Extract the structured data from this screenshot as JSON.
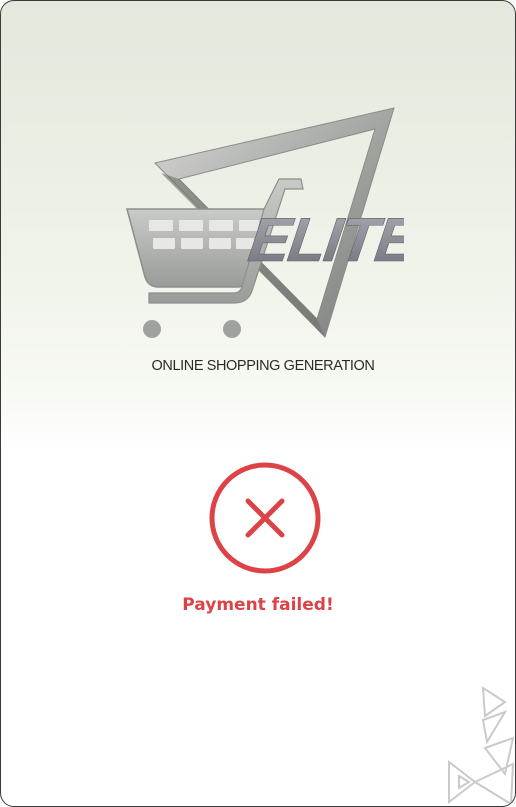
{
  "brand": {
    "logo_word": "ELITE",
    "tagline": "ONLINE SHOPPING GENERATION"
  },
  "payment": {
    "status_icon": "close-circle-icon",
    "message": "Payment failed!",
    "status_color": "#dd4346"
  },
  "decor": {
    "corner": "triangle-pattern"
  }
}
